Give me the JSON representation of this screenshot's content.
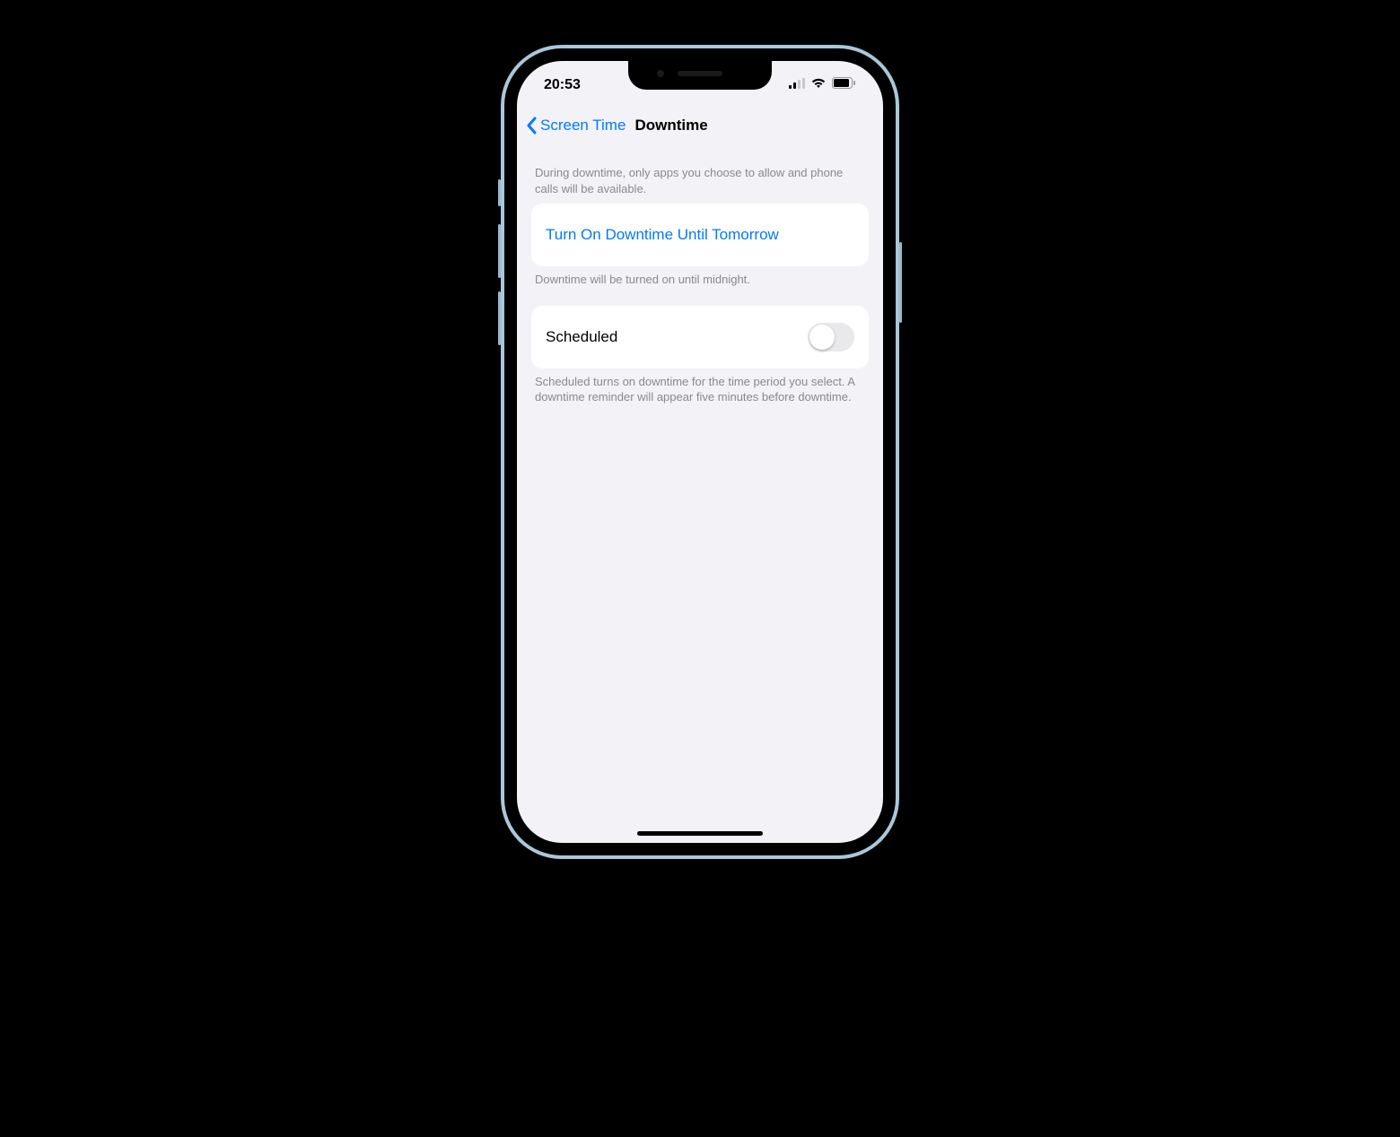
{
  "status": {
    "time": "20:53"
  },
  "nav": {
    "back_label": "Screen Time",
    "title": "Downtime"
  },
  "intro_text": "During downtime, only apps you choose to allow and phone calls will be available.",
  "turn_on": {
    "label": "Turn On Downtime Until Tomorrow",
    "footer": "Downtime will be turned on until midnight."
  },
  "scheduled": {
    "label": "Scheduled",
    "enabled": false,
    "footer": "Scheduled turns on downtime for the time period you select. A downtime reminder will appear five minutes before downtime."
  }
}
